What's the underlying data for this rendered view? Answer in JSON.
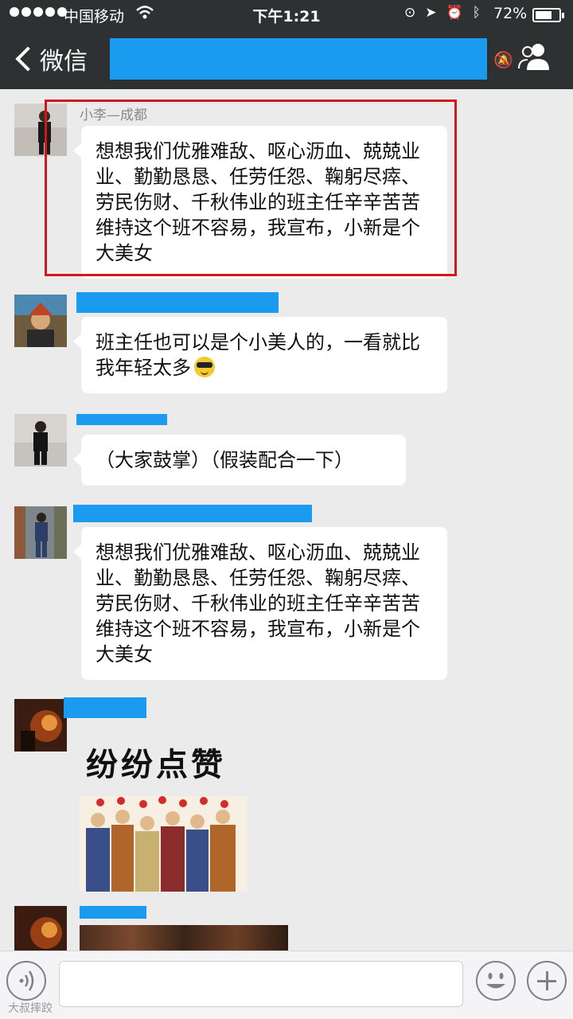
{
  "status_bar": {
    "carrier": "中国移动",
    "time": "下午1:21",
    "battery_percent": "72%",
    "battery_level": 0.72
  },
  "nav": {
    "back_label": "微信"
  },
  "messages": [
    {
      "nickname": "小李—成都",
      "text": "想想我们优雅难敌、呕心沥血、兢兢业业、勤勤恳恳、任劳任怨、鞠躬尽瘁、劳民伤财、千秋伟业的班主任辛辛苦苦维持这个班不容易，我宣布，小新是个大美女"
    },
    {
      "text": "班主任也可以是个小美人的，一看就比我年轻太多"
    },
    {
      "text": "（大家鼓掌）（假装配合一下）"
    },
    {
      "text": "想想我们优雅难敌、呕心沥血、兢兢业业、勤勤恳恳、任劳任怨、鞠躬尽瘁、劳民伤财、千秋伟业的班主任辛辛苦苦维持这个班不容易，我宣布，小新是个大美女"
    },
    {
      "sticker_caption": "纷纷点赞"
    }
  ],
  "watermark": "大叔摔跤",
  "colors": {
    "bar_bg": "#2e3132",
    "chat_bg": "#ebebeb",
    "mask_blue": "#1a9bf0",
    "highlight_red": "#d0171e"
  }
}
